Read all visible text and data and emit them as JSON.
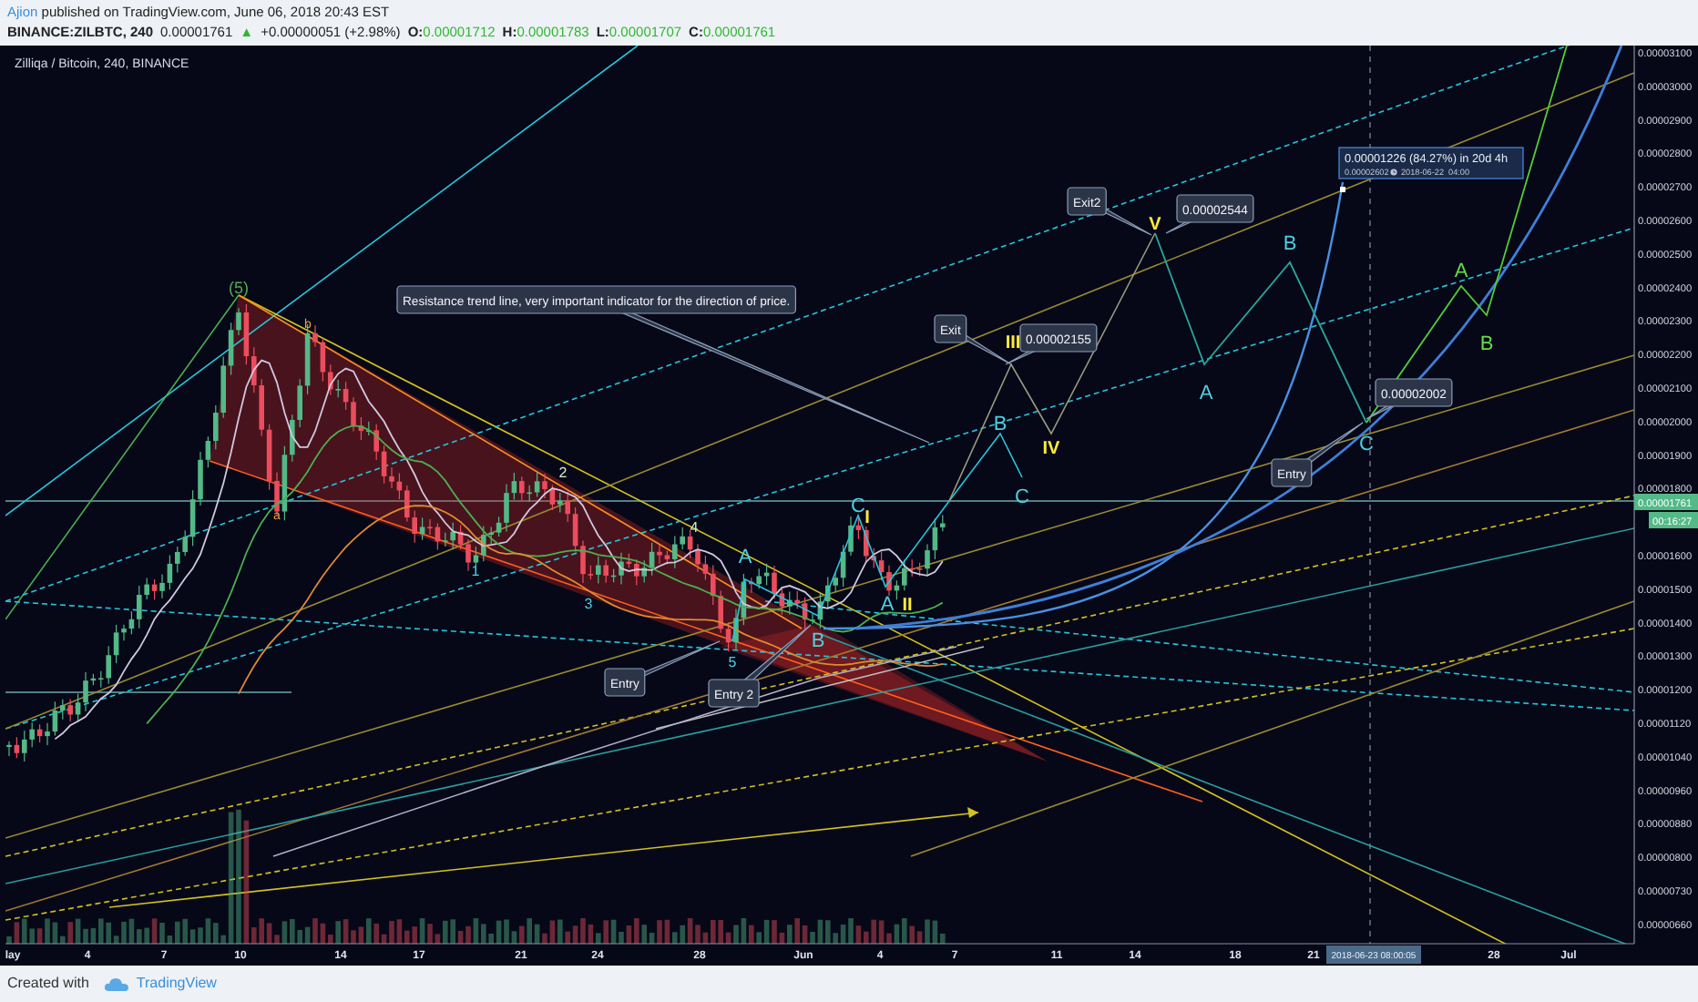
{
  "header": {
    "author": "Ajion",
    "published": "published on TradingView.com, June 06, 2018 20:43 EST"
  },
  "ticker": {
    "symbol": "BINANCE:ZILBTC, 240",
    "price": "0.00001761",
    "change_arrow": "▲",
    "change": "+0.00000051 (+2.98%)",
    "ohlc": [
      {
        "label": "O:",
        "value": "0.00001712"
      },
      {
        "label": "H:",
        "value": "0.00001783"
      },
      {
        "label": "L:",
        "value": "0.00001707"
      },
      {
        "label": "C:",
        "value": "0.00001761"
      }
    ]
  },
  "chart": {
    "title": "Zilliqa / Bitcoin, 240, BINANCE",
    "price_axis": [
      "0.00003100",
      "0.00003000",
      "0.00002900",
      "0.00002800",
      "0.00002700",
      "0.00002600",
      "0.00002500",
      "0.00002400",
      "0.00002300",
      "0.00002200",
      "0.00002100",
      "0.00002000",
      "0.00001900",
      "0.00001800",
      "0.00001600",
      "0.00001500",
      "0.00001400",
      "0.00001300",
      "0.00001200",
      "0.00001120",
      "0.00001040",
      "0.00000960",
      "0.00000880",
      "0.00000800",
      "0.00000730",
      "0.00000660"
    ],
    "current_price": "0.00001761",
    "countdown": "00:16:27",
    "time_axis": [
      "lay",
      "4",
      "7",
      "10",
      "14",
      "17",
      "21",
      "24",
      "28",
      "Jun",
      "4",
      "7",
      "11",
      "14",
      "18",
      "21",
      "28",
      "Jul"
    ],
    "crosshair_time": "2018-06-23 08:00:05",
    "wave_labels": [
      {
        "text": "(5)",
        "color": "#4caf50"
      },
      {
        "text": "b",
        "color": "#f0a040"
      },
      {
        "text": "a",
        "color": "#f0a040"
      },
      {
        "text": "1",
        "color": "#4dd0e1"
      },
      {
        "text": "2",
        "color": "#d8e8d0"
      },
      {
        "text": "3",
        "color": "#4dd0e1"
      },
      {
        "text": "4",
        "color": "#c8f0c8"
      },
      {
        "text": "5",
        "color": "#4dd0e1"
      },
      {
        "text": "A",
        "color": "#4dd0e1"
      },
      {
        "text": "B",
        "color": "#4dd0e1"
      },
      {
        "text": "C",
        "color": "#4dd0e1"
      },
      {
        "text": "I",
        "color": "#ffeb3b"
      },
      {
        "text": "A",
        "color": "#4dd0e1"
      },
      {
        "text": "II",
        "color": "#ffeb3b"
      },
      {
        "text": "III",
        "color": "#ffeb3b"
      },
      {
        "text": "B",
        "color": "#4dd0e1"
      },
      {
        "text": "C",
        "color": "#4dd0e1"
      },
      {
        "text": "IV",
        "color": "#ffeb3b"
      },
      {
        "text": "V",
        "color": "#ffeb3b"
      },
      {
        "text": "A",
        "color": "#4dd0e1"
      },
      {
        "text": "B",
        "color": "#4dd0e1"
      },
      {
        "text": "C",
        "color": "#4dd0e1"
      },
      {
        "text": "A",
        "color": "#66dd44"
      },
      {
        "text": "B",
        "color": "#66dd44"
      }
    ],
    "callouts": [
      {
        "text": "Resistance trend line, very important indicator for the direction of price."
      },
      {
        "text": "Entry"
      },
      {
        "text": "Entry 2"
      },
      {
        "text": "Exit"
      },
      {
        "text": "0.00002155"
      },
      {
        "text": "Exit2"
      },
      {
        "text": "0.00002544"
      },
      {
        "text": "0.00002002"
      },
      {
        "text": "Entry"
      }
    ],
    "measure": {
      "summary": "0.00001226 (84.27%) in 20d 4h",
      "price": "0.00002602",
      "date": "2018-06-22  04:00"
    }
  },
  "footer": {
    "created_with": "Created with",
    "brand": "TradingView"
  }
}
